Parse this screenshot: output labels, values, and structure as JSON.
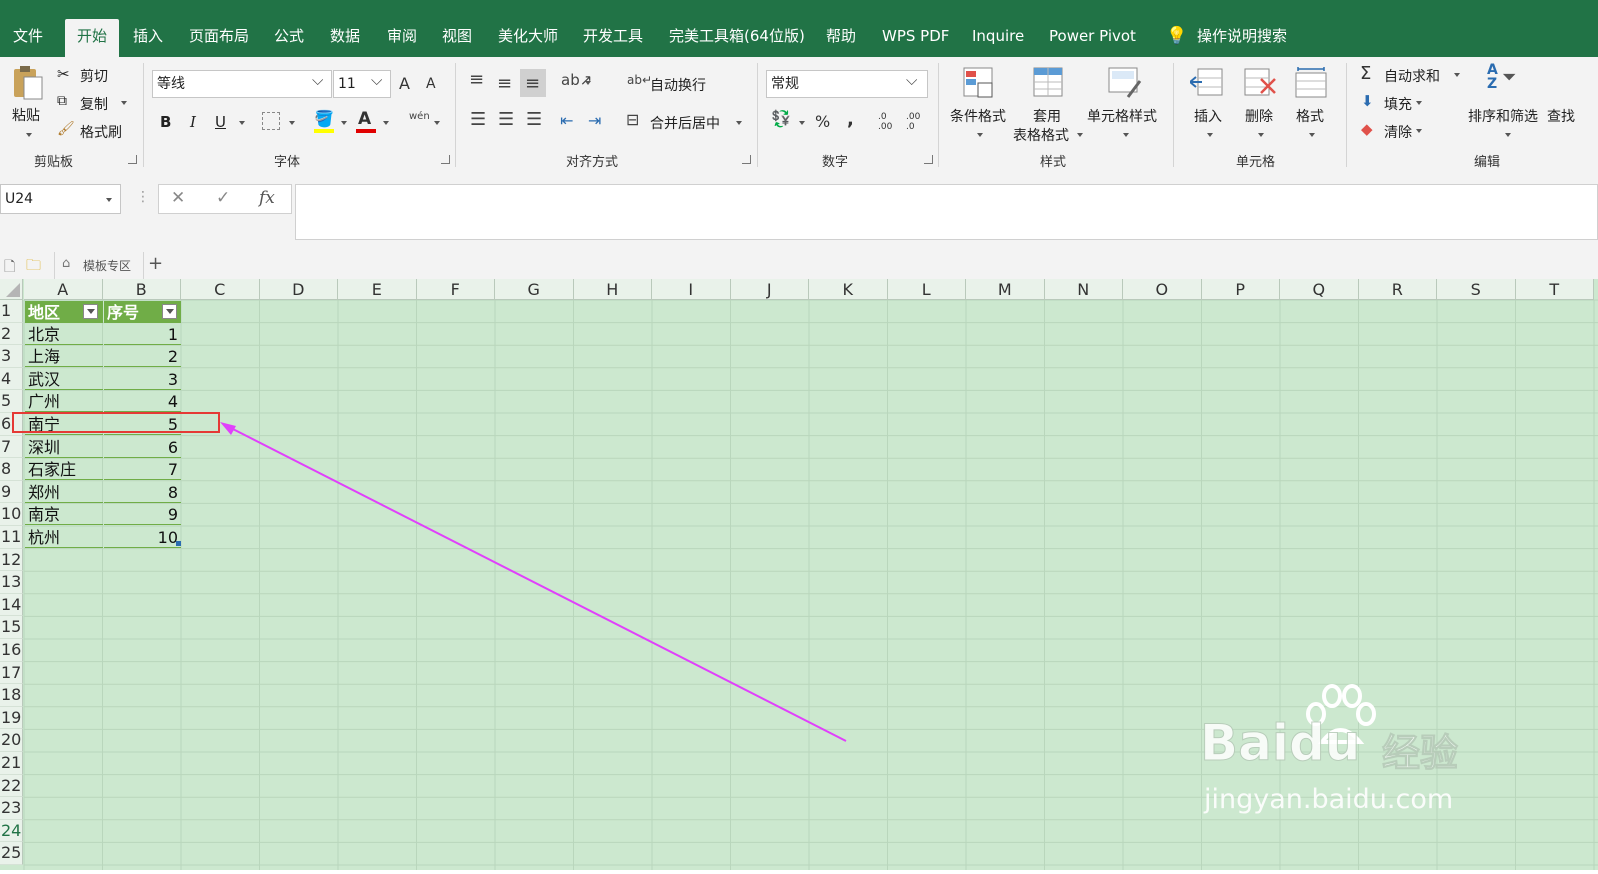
{
  "menu": {
    "tabs": [
      "文件",
      "开始",
      "插入",
      "页面布局",
      "公式",
      "数据",
      "审阅",
      "视图",
      "美化大师",
      "开发工具",
      "完美工具箱(64位版)",
      "帮助",
      "WPS PDF",
      "Inquire",
      "Power Pivot"
    ],
    "search": "操作说明搜索"
  },
  "ribbon": {
    "clipboard": {
      "paste": "粘贴",
      "cut": "剪切",
      "copy": "复制",
      "format_painter": "格式刷",
      "group": "剪贴板"
    },
    "font": {
      "name": "等线",
      "size": "11",
      "bold": "B",
      "italic": "I",
      "underline": "U",
      "grow": "A",
      "shrink": "A",
      "font_color_glyph": "A",
      "phonetic": "wén",
      "group": "字体"
    },
    "alignment": {
      "wrap": "自动换行",
      "merge": "合并后居中",
      "group": "对齐方式"
    },
    "number": {
      "format": "常规",
      "percent": "%",
      "comma": ",",
      "inc": ".0 .00",
      "dec": ".00 .0",
      "group": "数字"
    },
    "styles": {
      "conditional": "条件格式",
      "table_format_1": "套用",
      "table_format_2": "表格格式",
      "cell_styles": "单元格样式",
      "group": "样式"
    },
    "cells": {
      "insert": "插入",
      "delete": "删除",
      "format": "格式",
      "group": "单元格"
    },
    "editing": {
      "autosum": "自动求和",
      "fill": "填充",
      "clear": "清除",
      "sort_filter": "排序和筛选",
      "find": "查找",
      "group": "编辑"
    }
  },
  "formula_bar": {
    "name_box": "U24",
    "cancel": "✕",
    "enter": "✓",
    "fx": "fx",
    "value": ""
  },
  "doc_tabs": {
    "template": "模板专区",
    "add": "+"
  },
  "sheet": {
    "columns": [
      "A",
      "B",
      "C",
      "D",
      "E",
      "F",
      "G",
      "H",
      "I",
      "J",
      "K",
      "L",
      "M",
      "N",
      "O",
      "P",
      "Q",
      "R",
      "S",
      "T"
    ],
    "rows": [
      "1",
      "2",
      "3",
      "4",
      "5",
      "6",
      "7",
      "8",
      "9",
      "10",
      "11",
      "12",
      "13",
      "14",
      "15",
      "16",
      "17",
      "18",
      "19",
      "20",
      "21",
      "22",
      "23",
      "24",
      "25"
    ],
    "table": {
      "headers": [
        "地区",
        "序号"
      ],
      "data": [
        [
          "北京",
          "1"
        ],
        [
          "上海",
          "2"
        ],
        [
          "武汉",
          "3"
        ],
        [
          "广州",
          "4"
        ],
        [
          "南宁",
          "5"
        ],
        [
          "深圳",
          "6"
        ],
        [
          "石家庄",
          "7"
        ],
        [
          "郑州",
          "8"
        ],
        [
          "南京",
          "9"
        ],
        [
          "杭州",
          "10"
        ]
      ]
    },
    "selected_row": "6",
    "highlight_color": "#e53935",
    "arrow_color": "#e040fb",
    "header_fill": "#70ad47",
    "sheet_bg": "#cce8cf"
  },
  "watermark": {
    "brand": "Baidu",
    "suffix": "经验",
    "url": "jingyan.baidu.com"
  }
}
